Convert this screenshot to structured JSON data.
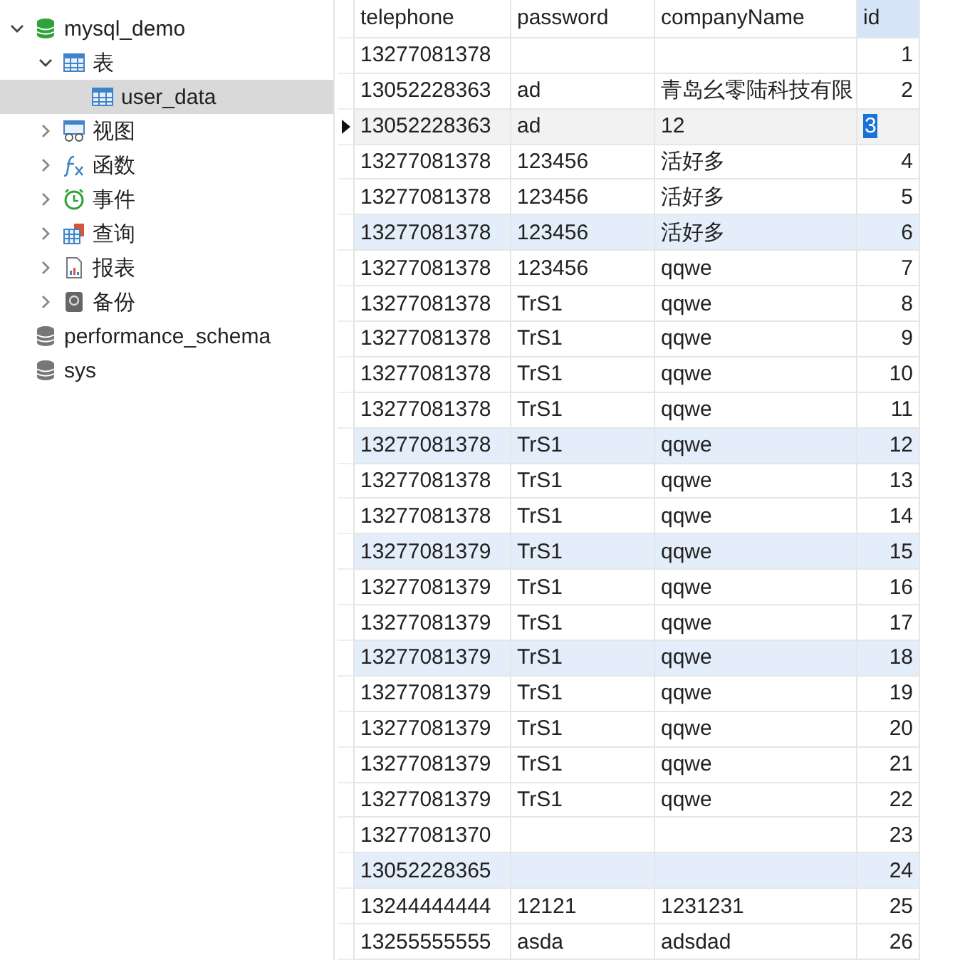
{
  "sidebar": {
    "items": [
      {
        "label": "mysql_demo",
        "kind": "database",
        "open": true,
        "expanded": true,
        "children": [
          {
            "label": "表",
            "kind": "tables",
            "expanded": true,
            "children": [
              {
                "label": "user_data",
                "kind": "table",
                "selected": true
              }
            ]
          },
          {
            "label": "视图",
            "kind": "views",
            "expanded": false
          },
          {
            "label": "函数",
            "kind": "functions",
            "expanded": false
          },
          {
            "label": "事件",
            "kind": "events",
            "expanded": false
          },
          {
            "label": "查询",
            "kind": "queries",
            "expanded": false
          },
          {
            "label": "报表",
            "kind": "reports",
            "expanded": false
          },
          {
            "label": "备份",
            "kind": "backups",
            "expanded": false
          }
        ]
      },
      {
        "label": "performance_schema",
        "kind": "database",
        "open": false
      },
      {
        "label": "sys",
        "kind": "database",
        "open": false
      }
    ]
  },
  "table": {
    "columns": [
      {
        "label": "telephone",
        "selected": false
      },
      {
        "label": "password",
        "selected": false
      },
      {
        "label": "companyName",
        "selected": false
      },
      {
        "label": "id",
        "selected": true
      }
    ],
    "rows": [
      {
        "cells": [
          "13277081378",
          "",
          "",
          "1"
        ],
        "selected": false,
        "highlighted": false
      },
      {
        "cells": [
          "13052228363",
          "ad",
          "青岛幺零陆科技有限",
          "2"
        ],
        "selected": false,
        "highlighted": false
      },
      {
        "cells": [
          "13052228363",
          "ad",
          "12",
          "3"
        ],
        "selected": true,
        "highlighted": false
      },
      {
        "cells": [
          "13277081378",
          "123456",
          "活好多",
          "4"
        ],
        "selected": false,
        "highlighted": false
      },
      {
        "cells": [
          "13277081378",
          "123456",
          "活好多",
          "5"
        ],
        "selected": false,
        "highlighted": false
      },
      {
        "cells": [
          "13277081378",
          "123456",
          "活好多",
          "6"
        ],
        "selected": false,
        "highlighted": true
      },
      {
        "cells": [
          "13277081378",
          "123456",
          "qqwe",
          "7"
        ],
        "selected": false,
        "highlighted": false
      },
      {
        "cells": [
          "13277081378",
          "TrS1",
          "qqwe",
          "8"
        ],
        "selected": false,
        "highlighted": false
      },
      {
        "cells": [
          "13277081378",
          "TrS1",
          "qqwe",
          "9"
        ],
        "selected": false,
        "highlighted": false
      },
      {
        "cells": [
          "13277081378",
          "TrS1",
          "qqwe",
          "10"
        ],
        "selected": false,
        "highlighted": false
      },
      {
        "cells": [
          "13277081378",
          "TrS1",
          "qqwe",
          "11"
        ],
        "selected": false,
        "highlighted": false
      },
      {
        "cells": [
          "13277081378",
          "TrS1",
          "qqwe",
          "12"
        ],
        "selected": false,
        "highlighted": true
      },
      {
        "cells": [
          "13277081378",
          "TrS1",
          "qqwe",
          "13"
        ],
        "selected": false,
        "highlighted": false
      },
      {
        "cells": [
          "13277081378",
          "TrS1",
          "qqwe",
          "14"
        ],
        "selected": false,
        "highlighted": false
      },
      {
        "cells": [
          "13277081379",
          "TrS1",
          "qqwe",
          "15"
        ],
        "selected": false,
        "highlighted": true
      },
      {
        "cells": [
          "13277081379",
          "TrS1",
          "qqwe",
          "16"
        ],
        "selected": false,
        "highlighted": false
      },
      {
        "cells": [
          "13277081379",
          "TrS1",
          "qqwe",
          "17"
        ],
        "selected": false,
        "highlighted": false
      },
      {
        "cells": [
          "13277081379",
          "TrS1",
          "qqwe",
          "18"
        ],
        "selected": false,
        "highlighted": true
      },
      {
        "cells": [
          "13277081379",
          "TrS1",
          "qqwe",
          "19"
        ],
        "selected": false,
        "highlighted": false
      },
      {
        "cells": [
          "13277081379",
          "TrS1",
          "qqwe",
          "20"
        ],
        "selected": false,
        "highlighted": false
      },
      {
        "cells": [
          "13277081379",
          "TrS1",
          "qqwe",
          "21"
        ],
        "selected": false,
        "highlighted": false
      },
      {
        "cells": [
          "13277081379",
          "TrS1",
          "qqwe",
          "22"
        ],
        "selected": false,
        "highlighted": false
      },
      {
        "cells": [
          "13277081370",
          "",
          "",
          "23"
        ],
        "selected": false,
        "highlighted": false
      },
      {
        "cells": [
          "13052228365",
          "",
          "",
          "24"
        ],
        "selected": false,
        "highlighted": true
      },
      {
        "cells": [
          "13244444444",
          "12121",
          "1231231",
          "25"
        ],
        "selected": false,
        "highlighted": false
      },
      {
        "cells": [
          "13255555555",
          "asda",
          "adsdad",
          "26"
        ],
        "selected": false,
        "highlighted": false
      }
    ]
  }
}
